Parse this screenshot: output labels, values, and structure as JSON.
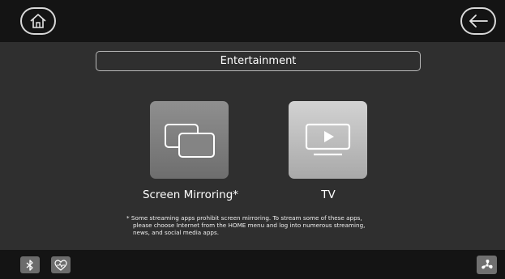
{
  "header": {
    "home_icon": "home-icon",
    "back_icon": "back-arrow-icon"
  },
  "page": {
    "title": "Entertainment"
  },
  "tiles": [
    {
      "label": "Screen Mirroring*",
      "icon": "screen-mirroring-icon"
    },
    {
      "label": "TV",
      "icon": "tv-play-icon"
    }
  ],
  "footnote": {
    "line1": "* Some streaming apps prohibit screen mirroring. To stream some of these apps,",
    "line2": "please choose Internet from the HOME menu and log into numerous streaming,",
    "line3": "news, and social media apps."
  },
  "footer": {
    "icons": [
      "bluetooth-icon",
      "heart-monitor-icon",
      "fan-icon"
    ]
  },
  "colors": {
    "background": "#2f2f2f",
    "bar": "#141414",
    "tile_mirror": "#7f7f7f",
    "tile_tv": "#c0c0c0"
  }
}
